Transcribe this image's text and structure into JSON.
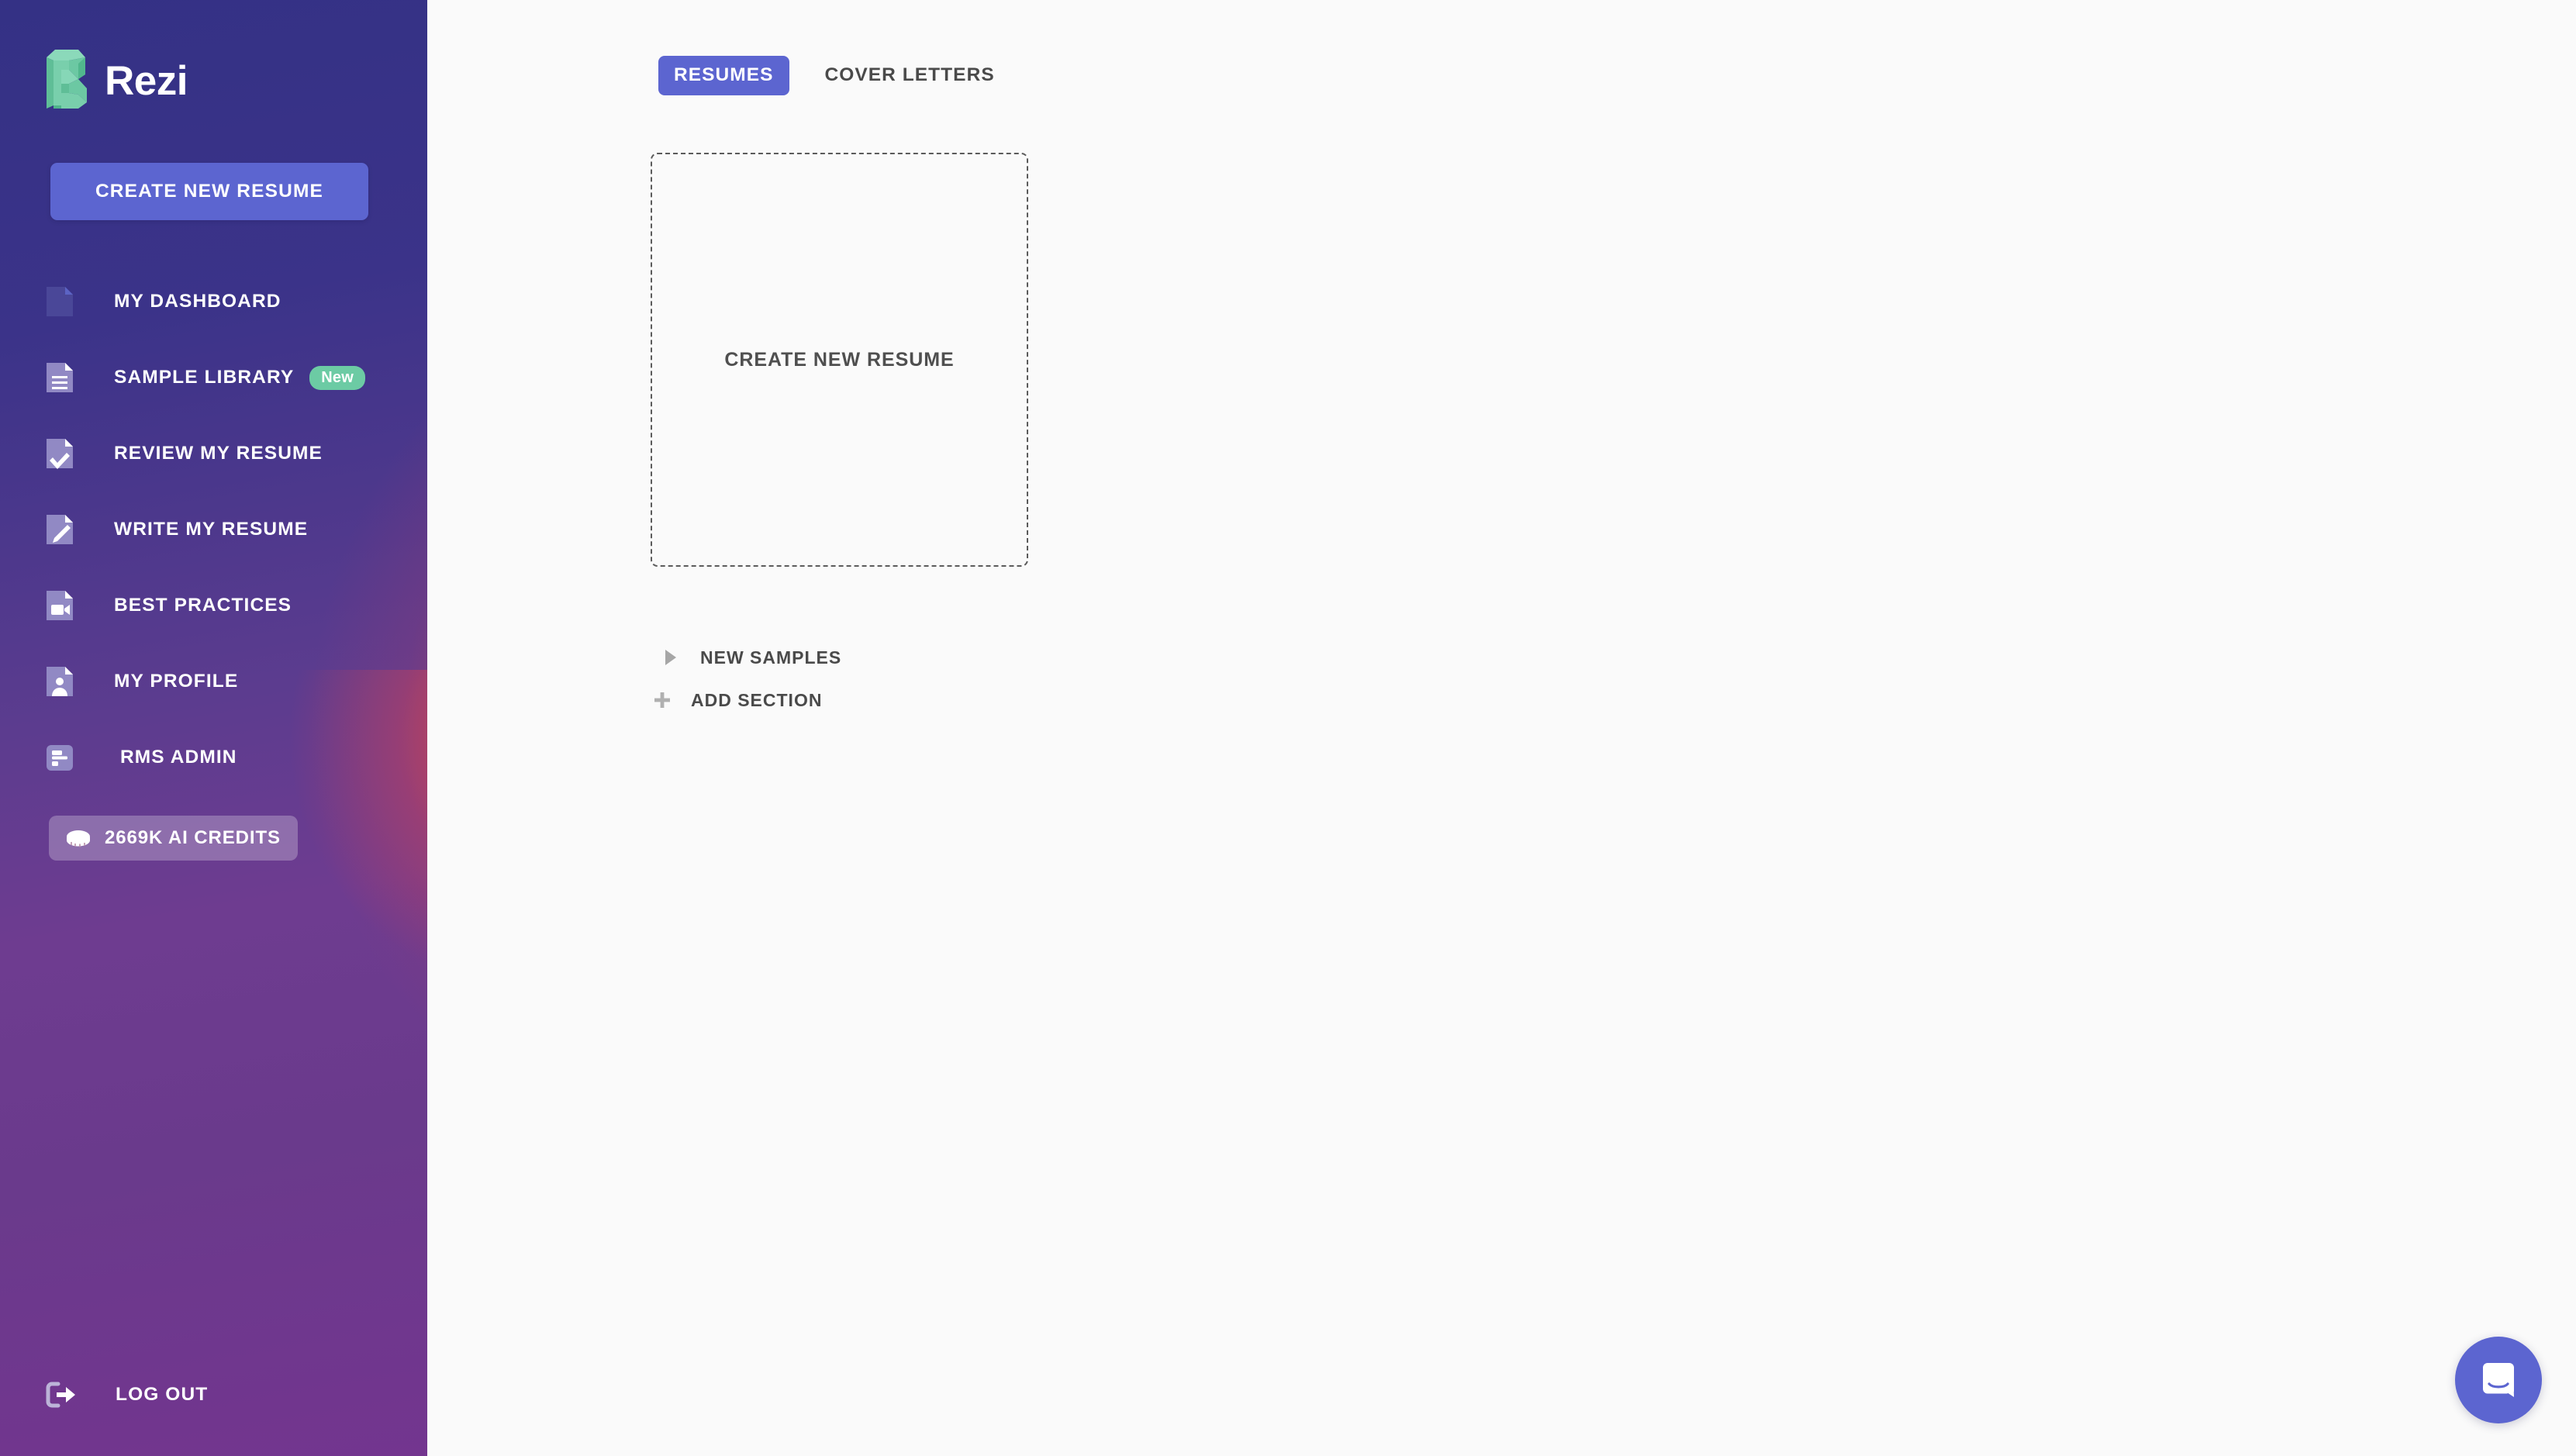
{
  "brand": {
    "name": "Rezi",
    "logo_icon": "rezi-origami-r-logo",
    "logo_color": "#6DCBA4"
  },
  "sidebar": {
    "cta": {
      "label": "CREATE NEW RESUME",
      "color": "#5C65D0"
    },
    "items": [
      {
        "label": "MY DASHBOARD",
        "icon": "document-icon",
        "badge": null,
        "active": true
      },
      {
        "label": "SAMPLE LIBRARY",
        "icon": "document-lines-icon",
        "badge": "New",
        "badge_color": "#6CCBA4"
      },
      {
        "label": "REVIEW MY RESUME",
        "icon": "document-check-icon",
        "badge": null
      },
      {
        "label": "WRITE MY RESUME",
        "icon": "document-pencil-icon",
        "badge": null
      },
      {
        "label": "BEST PRACTICES",
        "icon": "document-video-icon",
        "badge": null
      },
      {
        "label": "MY PROFILE",
        "icon": "document-person-icon",
        "badge": null
      },
      {
        "label": "RMS ADMIN",
        "icon": "list-bars-icon",
        "badge": null
      }
    ],
    "credits": {
      "label": "2669K AI CREDITS",
      "icon": "coin-icon"
    },
    "logout": {
      "label": "LOG OUT",
      "icon": "logout-arrow-icon"
    }
  },
  "main": {
    "tabs": [
      {
        "label": "RESUMES",
        "active": true
      },
      {
        "label": "COVER LETTERS",
        "active": false
      }
    ],
    "create_card": {
      "label": "CREATE NEW RESUME"
    },
    "sections": [
      {
        "label": "NEW SAMPLES",
        "icon": "caret-right-icon"
      },
      {
        "label": "ADD SECTION",
        "icon": "plus-icon"
      }
    ]
  },
  "support": {
    "launcher": {
      "icon": "chat-bubble-smile-icon",
      "color": "#5C65D0"
    }
  }
}
